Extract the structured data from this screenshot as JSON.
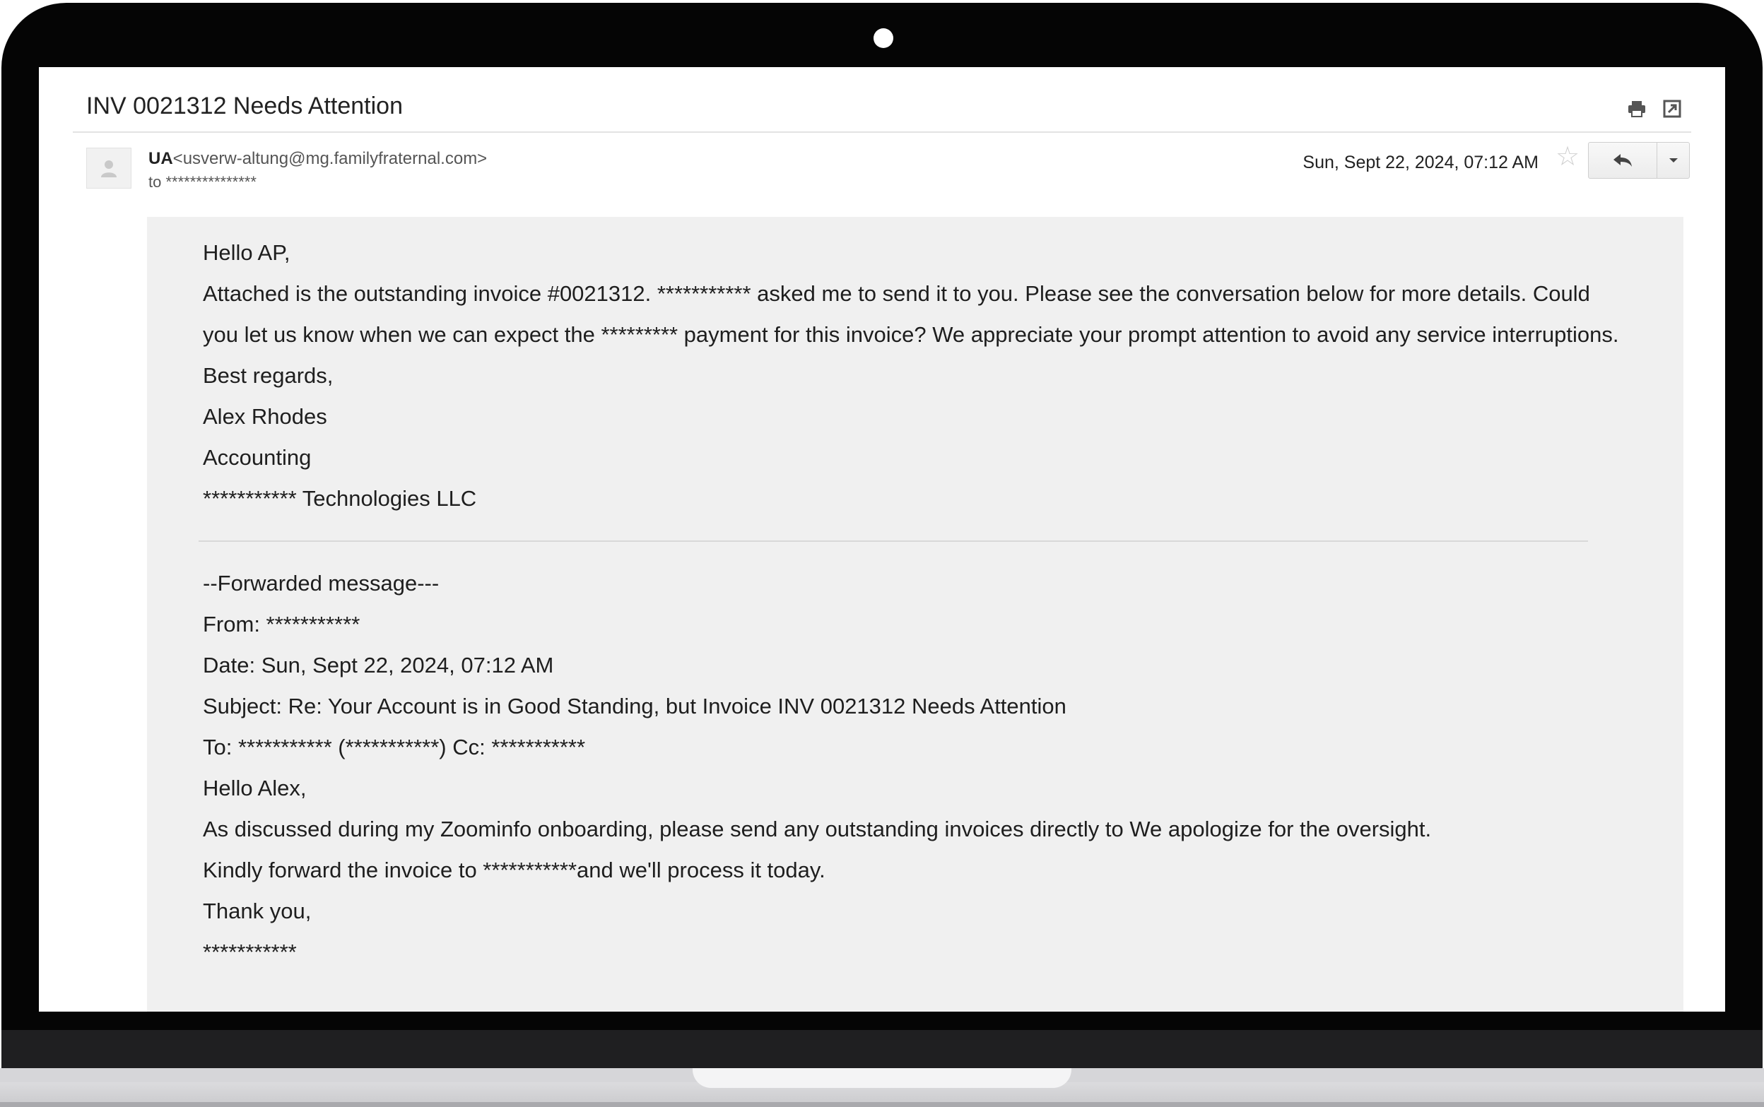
{
  "email": {
    "subject": "INV 0021312 Needs Attention",
    "sender_name": "UA",
    "sender_email": "<usverw-altung@mg.familyfraternal.com>",
    "to_label": "to",
    "to_value": "***************",
    "date": "Sun, Sept 22, 2024, 07:12 AM",
    "body": {
      "greeting": "Hello AP,",
      "paragraph": "Attached is the outstanding invoice #0021312. *********** asked me to send it to you. Please see the conversation below for more details. Could you let us know when we can expect the ********* payment for this invoice? We appreciate your prompt attention to avoid any service interruptions.",
      "closing": "Best regards,",
      "signer_name": "Alex Rhodes",
      "signer_dept": "Accounting",
      "signer_company": "*********** Technologies LLC"
    },
    "forwarded": {
      "header": "--Forwarded message---",
      "from": "From: ***********",
      "date": "Date: Sun, Sept 22, 2024, 07:12 AM",
      "subject": "Subject: Re: Your Account is in Good Standing, but Invoice INV 0021312 Needs Attention",
      "to_cc": "To: *********** (***********) Cc: ***********",
      "greeting": "Hello Alex,",
      "line1": "As discussed during my Zoominfo onboarding, please send any outstanding invoices directly to We apologize for the oversight.",
      "line2": "Kindly forward the invoice to ***********and we'll process it today.",
      "closing": "Thank you,",
      "signature": "***********"
    }
  },
  "icons": {
    "print": "print-icon",
    "popout": "new-window-icon",
    "star": "star-icon",
    "reply": "reply-icon",
    "more": "chevron-down-icon",
    "avatar": "person-icon"
  },
  "colors": {
    "body_background": "#f0f0f0",
    "bezel": "#050505"
  }
}
